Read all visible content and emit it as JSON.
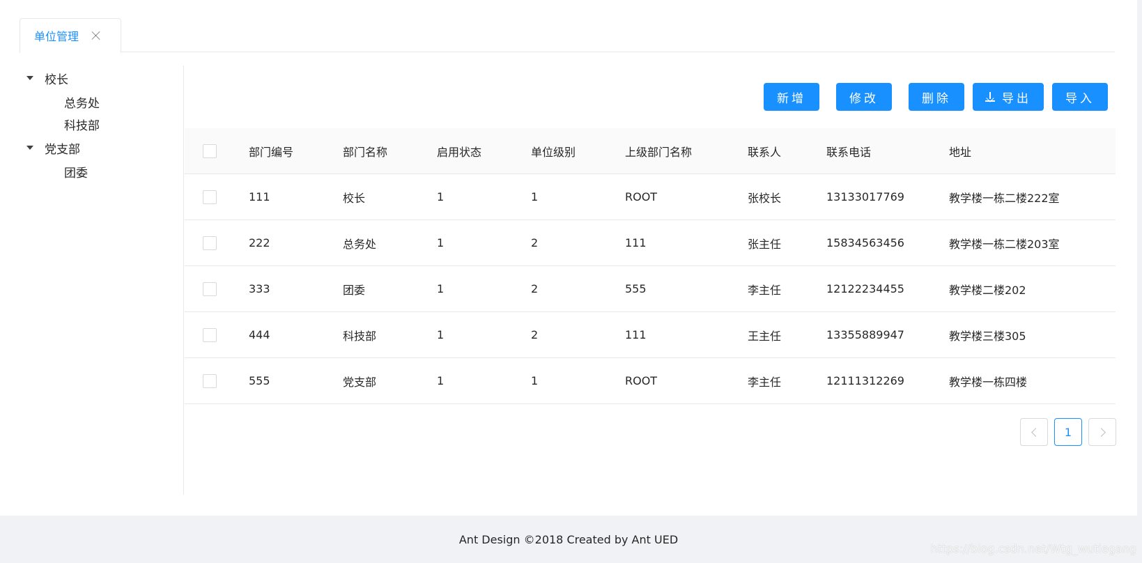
{
  "tabs": [
    {
      "label": "单位管理",
      "active": true,
      "closable": true
    }
  ],
  "tree": [
    {
      "label": "校长",
      "expanded": true,
      "level": 0
    },
    {
      "label": "总务处",
      "level": 1
    },
    {
      "label": "科技部",
      "level": 1
    },
    {
      "label": "党支部",
      "expanded": true,
      "level": 0
    },
    {
      "label": "团委",
      "level": 1
    }
  ],
  "toolbar": {
    "add": "新增",
    "edit": "修改",
    "delete": "删除",
    "export": "导出",
    "import": "导入"
  },
  "table": {
    "columns": [
      "部门编号",
      "部门名称",
      "启用状态",
      "单位级别",
      "上级部门名称",
      "联系人",
      "联系电话",
      "地址"
    ],
    "rows": [
      [
        "111",
        "校长",
        "1",
        "1",
        "ROOT",
        "张校长",
        "13133017769",
        "教学楼一栋二楼222室"
      ],
      [
        "222",
        "总务处",
        "1",
        "2",
        "111",
        "张主任",
        "15834563456",
        "教学楼一栋二楼203室"
      ],
      [
        "333",
        "团委",
        "1",
        "2",
        "555",
        "李主任",
        "12122234455",
        "教学楼二楼202"
      ],
      [
        "444",
        "科技部",
        "1",
        "2",
        "111",
        "王主任",
        "13355889947",
        "教学楼三楼305"
      ],
      [
        "555",
        "党支部",
        "1",
        "1",
        "ROOT",
        "李主任",
        "12111312269",
        "教学楼一栋四楼"
      ]
    ]
  },
  "pagination": {
    "current": "1"
  },
  "footer": {
    "text": "Ant Design ©2018 Created by Ant UED"
  },
  "watermark": "https://blog.csdn.net/Wtg_wutiegang",
  "colors": {
    "primary": "#1890ff",
    "footer_bg": "#f0f2f5",
    "border": "#e8e8e8"
  }
}
